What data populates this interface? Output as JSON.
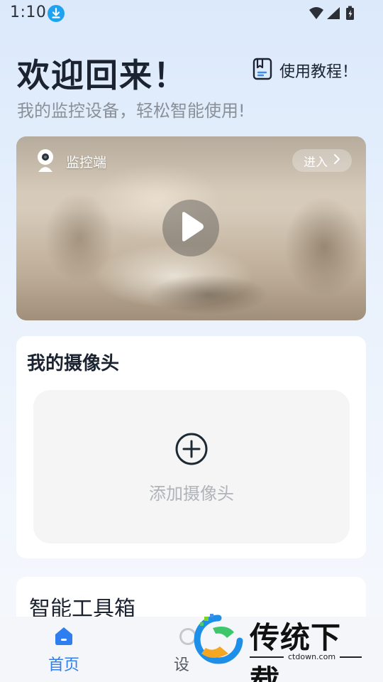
{
  "status_bar": {
    "time": "1:10",
    "icons": [
      "download-icon",
      "wifi-icon",
      "signal-icon",
      "battery-icon"
    ]
  },
  "header": {
    "welcome_title": "欢迎回来！",
    "subtitle": "我的监控设备，轻松智能使用!",
    "tutorial_label": "使用教程！",
    "tutorial_icon": "book-icon"
  },
  "banner": {
    "label": "监控端",
    "enter_label": "进入",
    "camera_icon": "camera-icon",
    "play_icon": "play-icon"
  },
  "my_cameras": {
    "title": "我的摄像头",
    "add_label": "添加摄像头",
    "add_icon": "plus-circle-icon"
  },
  "toolbox": {
    "title": "智能工具箱"
  },
  "bottom_nav": {
    "items": [
      {
        "label": "首页",
        "icon": "home-icon",
        "active": true
      },
      {
        "label": "设",
        "icon": "device-icon",
        "active": false
      }
    ],
    "active_color": "#2f7ef0"
  },
  "watermark": {
    "text": "传统下载",
    "url": "ctdown.com"
  },
  "colors": {
    "accent": "#2f7ef0",
    "download_badge": "#1fa3f0"
  }
}
